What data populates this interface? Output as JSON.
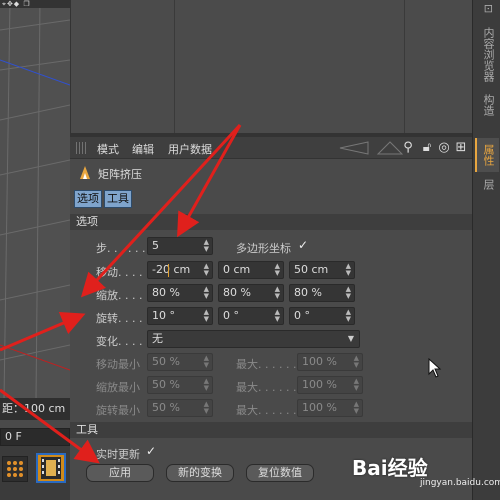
{
  "viewport": {
    "top_icons": "⌖✥◆ ❐",
    "status_text": "距：100 cm",
    "frame_value": "0 F"
  },
  "right_tabs": [
    "⊡",
    "内容浏览器",
    "构造",
    "属性",
    "层"
  ],
  "attribute_manager": {
    "menus": [
      "模式",
      "编辑",
      "用户数据"
    ],
    "tool_icons": [
      "search-icon",
      "lock-icon",
      "target-icon",
      "add-icon"
    ],
    "object_name": "矩阵挤压",
    "tabs": [
      "选项",
      "工具"
    ],
    "options_section": "选项",
    "params": {
      "steps_label": "步. . . . . .",
      "steps_value": "5",
      "polygon_coords_label": "多边形坐标",
      "polygon_coords_checked": true,
      "move_label": "移动. . . .",
      "move": [
        "-20 cm",
        "0 cm",
        "50 cm"
      ],
      "scale_label": "缩放. . . .",
      "scale": [
        "80 %",
        "80 %",
        "80 %"
      ],
      "rotate_label": "旋转. . . .",
      "rotate": [
        "10 °",
        "0 °",
        "0 °"
      ],
      "variation_label": "变化. . . .",
      "variation_value": "无",
      "move_min_label": "移动最小",
      "move_min": "50 %",
      "move_max_label": "最大. . . . . .",
      "move_max": "100 %",
      "scale_min_label": "缩放最小",
      "scale_min": "50 %",
      "scale_max_label": "最大. . . . . .",
      "scale_max": "100 %",
      "rotate_min_label": "旋转最小",
      "rotate_min": "50 %",
      "rotate_max_label": "最大. . . . . .",
      "rotate_max": "100 %"
    },
    "tools_section": "工具",
    "realtime_update_label": "实时更新",
    "realtime_update_checked": true,
    "buttons": {
      "apply": "应用",
      "new_transform": "新的变换",
      "reset_values": "复位数值"
    }
  },
  "colors": {
    "panel_bg": "#4a4a4a",
    "active_tab": "#7fa4cc",
    "accent_orange": "#e8a640",
    "annotation_red": "#e0201c"
  },
  "watermark": {
    "brand": "Bai经验",
    "url": "jingyan.baidu.com"
  }
}
